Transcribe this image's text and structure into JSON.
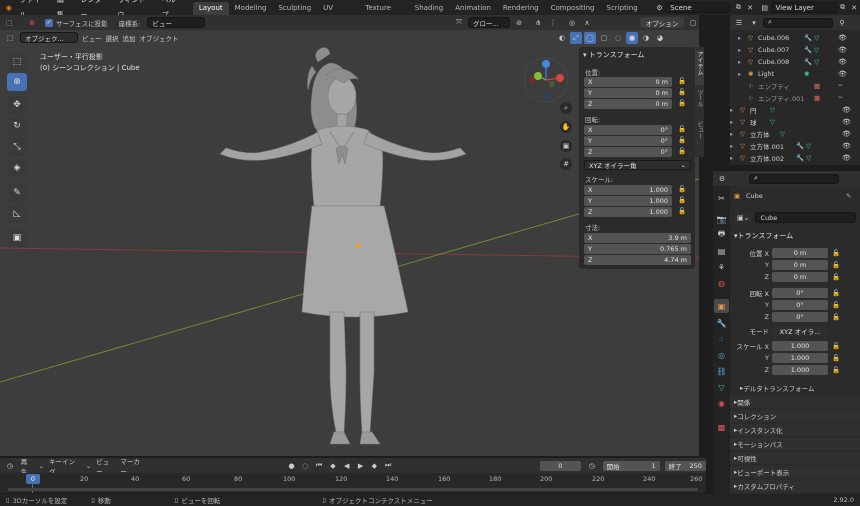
{
  "menu": {
    "items": [
      "ファイル",
      "編集",
      "レンダー",
      "ウィンドウ",
      "ヘルプ"
    ],
    "workspaces": [
      "Layout",
      "Modeling",
      "Sculpting",
      "UV Editing",
      "Texture Paint",
      "Shading",
      "Animation",
      "Rendering",
      "Compositing",
      "Scripting"
    ],
    "active_workspace": "Layout",
    "scene": "Scene",
    "view_layer": "View Layer"
  },
  "viewport_header": {
    "snap_label": "サーフェスに投影",
    "orientation_label": "座標系:",
    "orientation_value": "ビュー",
    "transform_value": "グロー...",
    "options": "オプション",
    "mode": "オブジェク...",
    "menu": [
      "ビュー",
      "選択",
      "追加",
      "オブジェクト"
    ]
  },
  "viewport": {
    "view_name": "ユーザー・平行投影",
    "collection_info": "(0) シーンコレクション | Cube",
    "colors": {
      "background": "#3d3d3d",
      "x_axis": "#8a3a3a",
      "y_axis": "#6d8a2e",
      "accent": "#4772b3"
    }
  },
  "npanel": {
    "title": "トランスフォーム",
    "location_label": "位置:",
    "location": [
      {
        "axis": "X",
        "value": "0 m"
      },
      {
        "axis": "Y",
        "value": "0 m"
      },
      {
        "axis": "Z",
        "value": "0 m"
      }
    ],
    "rotation_label": "回転:",
    "rotation": [
      {
        "axis": "X",
        "value": "0°"
      },
      {
        "axis": "Y",
        "value": "0°"
      },
      {
        "axis": "Z",
        "value": "0°"
      }
    ],
    "rotation_mode": "XYZ オイラー角",
    "scale_label": "スケール:",
    "scale": [
      {
        "axis": "X",
        "value": "1.000"
      },
      {
        "axis": "Y",
        "value": "1.000"
      },
      {
        "axis": "Z",
        "value": "1.000"
      }
    ],
    "dimensions_label": "寸法:",
    "dimensions": [
      {
        "axis": "X",
        "value": "3.9 m"
      },
      {
        "axis": "Y",
        "value": "0.765 m"
      },
      {
        "axis": "Z",
        "value": "4.74 m"
      }
    ],
    "side_tabs": [
      "アイテム",
      "ツール",
      "ビュー"
    ]
  },
  "outliner": {
    "items": [
      {
        "name": "Cube.006",
        "icon": "mesh-icon"
      },
      {
        "name": "Cube.007",
        "icon": "mesh-icon"
      },
      {
        "name": "Cube.008",
        "icon": "mesh-icon"
      },
      {
        "name": "Light",
        "icon": "light-icon"
      },
      {
        "name": "エンプティ",
        "icon": "empty-icon"
      },
      {
        "name": "エンプティ.001",
        "icon": "empty-icon"
      },
      {
        "name": "円",
        "icon": "mesh-icon"
      },
      {
        "name": "球",
        "icon": "mesh-icon"
      },
      {
        "name": "立方体",
        "icon": "mesh-icon"
      },
      {
        "name": "立方体.001",
        "icon": "mesh-icon"
      },
      {
        "name": "立方体.002",
        "icon": "mesh-icon"
      }
    ]
  },
  "properties": {
    "object_name": "Cube",
    "data_name": "Cube",
    "transform_title": "トランスフォーム",
    "location_label": "位置 X",
    "location": [
      "0 m",
      "0 m",
      "0 m"
    ],
    "rotation_label": "回転 X",
    "rotation": [
      "0°",
      "0°",
      "0°"
    ],
    "mode_label": "モード",
    "mode_value": "XYZ オイラ...",
    "scale_label": "スケール X",
    "scale": [
      "1.000",
      "1.000",
      "1.000"
    ],
    "axes": [
      "X",
      "Y",
      "Z"
    ],
    "sections": [
      "デルタトランスフォーム",
      "関係",
      "コレクション",
      "インスタンス化",
      "モーションパス",
      "可視性",
      "ビューポート表示",
      "カスタムプロパティ"
    ]
  },
  "timeline": {
    "menu": [
      "再生",
      "キーイング",
      "ビュー",
      "マーカー"
    ],
    "current_frame": "0",
    "start_label": "開始",
    "start": "1",
    "end_label": "終了",
    "end": "250",
    "ruler": [
      "0",
      "20",
      "40",
      "60",
      "80",
      "100",
      "120",
      "140",
      "160",
      "180",
      "200",
      "220",
      "240",
      "260"
    ]
  },
  "status": {
    "left1": "3Dカーソルを設定",
    "left2": "移動",
    "mid": "ビューを回転",
    "right": "オブジェクトコンテクストメニュー",
    "version": "2.92.0"
  }
}
